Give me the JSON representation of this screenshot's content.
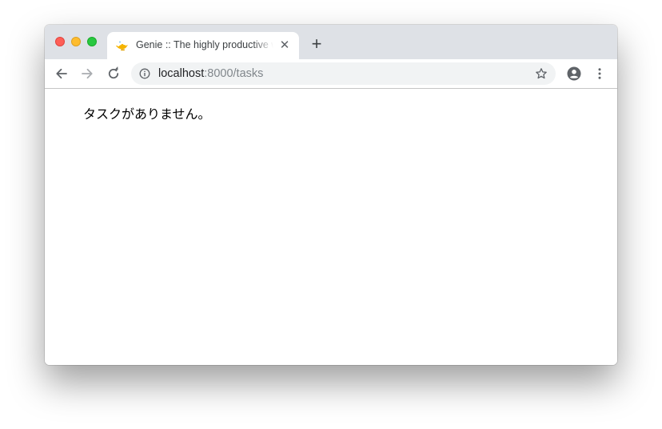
{
  "browser": {
    "tab": {
      "title": "Genie :: The highly productive web framework for Julia",
      "favicon": "genie-lamp-icon"
    },
    "address_bar": {
      "host": "localhost",
      "path": ":8000/tasks"
    },
    "icons": {
      "back": "arrow-left-icon",
      "forward": "arrow-right-icon",
      "reload": "reload-icon",
      "site_info": "info-icon",
      "bookmark": "star-icon",
      "profile": "account-icon",
      "menu": "kebab-menu-icon",
      "close_tab": "close-icon",
      "new_tab": "plus-icon"
    },
    "colors": {
      "titlebar": "#dee1e6",
      "omnibox": "#f1f3f4",
      "close_light": "#fe5f57",
      "minimize_light": "#febc2e",
      "maximize_light": "#28c840"
    }
  },
  "page": {
    "message": "タスクがありません。"
  }
}
